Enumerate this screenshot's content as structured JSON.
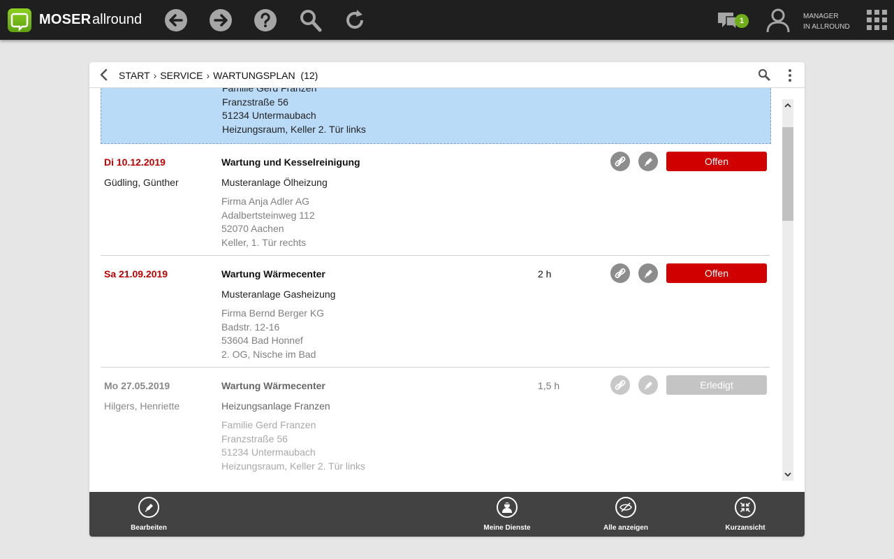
{
  "app": {
    "brand": "MOSER",
    "product": "allround"
  },
  "topbar": {
    "icons": [
      "back-icon",
      "forward-icon",
      "help-icon",
      "search-icon",
      "refresh-icon",
      "chat-icon",
      "user-icon",
      "apps-grid-icon"
    ],
    "chat_badge": "1",
    "user_role_line1": "MANAGER",
    "user_role_line2": "IN ALLROUND"
  },
  "breadcrumb": {
    "items": [
      "START",
      "SERVICE",
      "WARTUNGSPLAN"
    ],
    "separator": "›",
    "count": "(12)"
  },
  "list": {
    "items": [
      {
        "partial": true,
        "selected": true,
        "address": [
          "Familie Gerd Franzen",
          "Franzstraße 56",
          "51234 Untermaubach",
          "Heizungsraum, Keller 2. Tür links"
        ]
      },
      {
        "date": "Di 10.12.2019",
        "technician": "Güdling, Günther",
        "title": "Wartung und Kesselreinigung",
        "plant": "Musteranlage Ölheizung",
        "address": [
          "Firma Anja Adler AG",
          "Adalbertsteinweg 112",
          "52070 Aachen",
          "Keller, 1. Tür rechts"
        ],
        "duration": "",
        "status": "Offen"
      },
      {
        "date": "Sa 21.09.2019",
        "technician": "",
        "title": "Wartung Wärmecenter",
        "plant": "Musteranlage Gasheizung",
        "address": [
          "Firma Bernd Berger KG",
          "Badstr. 12-16",
          "53604 Bad Honnef",
          "2. OG, Nische im Bad"
        ],
        "duration": "2 h",
        "status": "Offen"
      },
      {
        "date": "Mo 27.05.2019",
        "technician": "Hilgers, Henriette",
        "title": "Wartung Wärmecenter",
        "plant": "Heizungsanlage Franzen",
        "address": [
          "Familie Gerd Franzen",
          "Franzstraße 56",
          "51234 Untermaubach",
          "Heizungsraum, Keller 2. Tür links"
        ],
        "duration": "1,5 h",
        "status": "Erledigt"
      }
    ]
  },
  "toolbar": {
    "edit": "Bearbeiten",
    "my_services": "Meine Dienste",
    "show_all": "Alle anzeigen",
    "short_view": "Kurzansicht"
  },
  "colors": {
    "accent_green": "#6fae19",
    "status_open": "#d10000",
    "status_done": "#c4c4c4",
    "date_red": "#c00000",
    "selection_blue": "#b9dbf7",
    "topbar": "#1f1f1f",
    "toolbar": "#424242"
  }
}
